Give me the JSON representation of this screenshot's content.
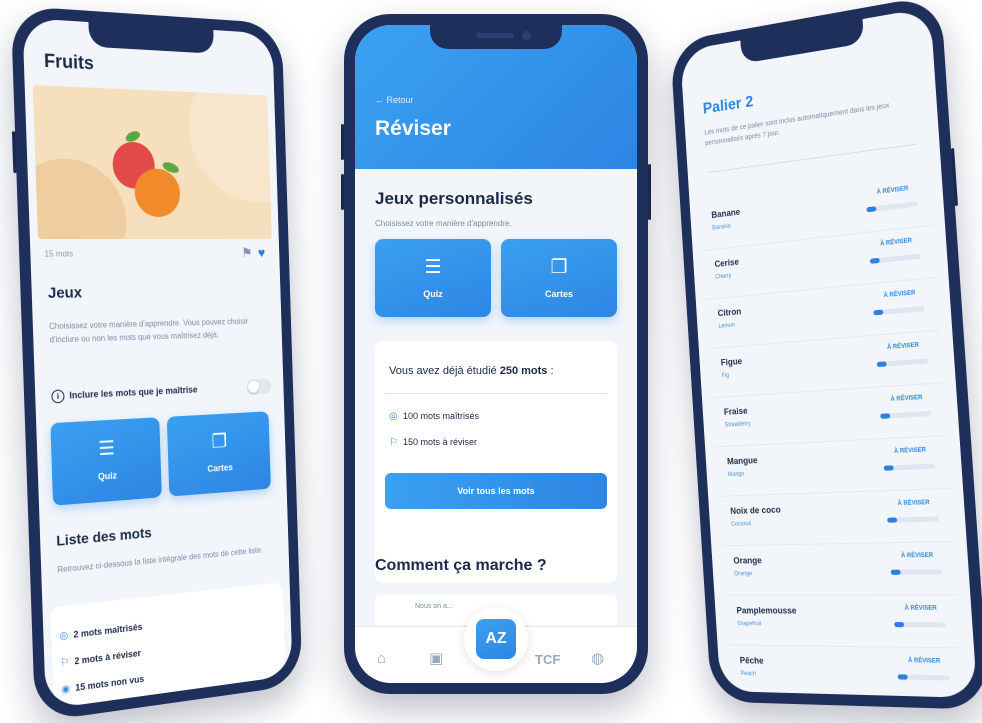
{
  "left_screen": {
    "title": "Fruits",
    "word_count": "15 mots",
    "jeux": {
      "title": "Jeux",
      "description": "Choisissez votre manière d'apprendre. Vous pouvez choisir d'inclure ou non les mots que vous maîtrisez déjà.",
      "toggle_label": "Inclure les mots que je maîtrise",
      "toggle_on": false,
      "quiz_label": "Quiz",
      "cards_label": "Cartes"
    },
    "word_list": {
      "title": "Liste des mots",
      "description": "Retrouvez ci-dessous la liste intégrale des mots de cette liste.",
      "mastered": "2 mots maîtrisés",
      "to_review": "2 mots à réviser",
      "unseen": "15 mots non vus"
    }
  },
  "center_screen": {
    "back": "← Retour",
    "title": "Réviser",
    "games": {
      "title": "Jeux personnalisés",
      "subtitle": "Choisissez votre manière d'apprendre.",
      "quiz_label": "Quiz",
      "cards_label": "Cartes"
    },
    "studied": {
      "prefix": "Vous avez déjà étudié ",
      "count": "250 mots",
      "suffix": " :",
      "mastered": "100 mots maîtrisés",
      "to_review": "150 mots à réviser",
      "button": "Voir tous les mots"
    },
    "how": {
      "title": "Comment ça marche ?",
      "preview": "Nous on a..."
    },
    "tabbar": {
      "fab_label": "AZ",
      "tcf_label": "TCF"
    }
  },
  "right_screen": {
    "title": "Palier 2",
    "description": "Les mots de ce palier sont inclus automatiquement dans les jeux personnalisés après 7 jour.",
    "words": [
      {
        "word": "Banane",
        "translation": "Banana",
        "status": "À RÉVISER",
        "progress": 0.2
      },
      {
        "word": "Cerise",
        "translation": "Cherry",
        "status": "À RÉVISER",
        "progress": 0.2
      },
      {
        "word": "Citron",
        "translation": "Lemon",
        "status": "À RÉVISER",
        "progress": 0.2
      },
      {
        "word": "Figue",
        "translation": "Fig",
        "status": "À RÉVISER",
        "progress": 0.2
      },
      {
        "word": "Fraise",
        "translation": "Strawberry",
        "status": "À RÉVISER",
        "progress": 0.2
      },
      {
        "word": "Mangue",
        "translation": "Mango",
        "status": "À RÉVISER",
        "progress": 0.2
      },
      {
        "word": "Noix de coco",
        "translation": "Coconut",
        "status": "À RÉVISER",
        "progress": 0.2
      },
      {
        "word": "Orange",
        "translation": "Orange",
        "status": "À RÉVISER",
        "progress": 0.2
      },
      {
        "word": "Pamplemousse",
        "translation": "Grapefruit",
        "status": "À RÉVISER",
        "progress": 0.2
      },
      {
        "word": "Pêche",
        "translation": "Peach",
        "status": "À RÉVISER",
        "progress": 0.2
      }
    ]
  },
  "colors": {
    "frame": "#1f2f5c",
    "accent": "#2d86e4",
    "text_dark": "#1b2a4a",
    "illustration_bg": "#f5dfbd"
  },
  "icons": [
    "bookmark-icon",
    "heart-icon",
    "info-icon",
    "quiz-icon",
    "cards-icon",
    "check-circle-icon",
    "flag-icon",
    "home-icon",
    "calendar-icon",
    "globe-icon",
    "dictionary-icon"
  ]
}
